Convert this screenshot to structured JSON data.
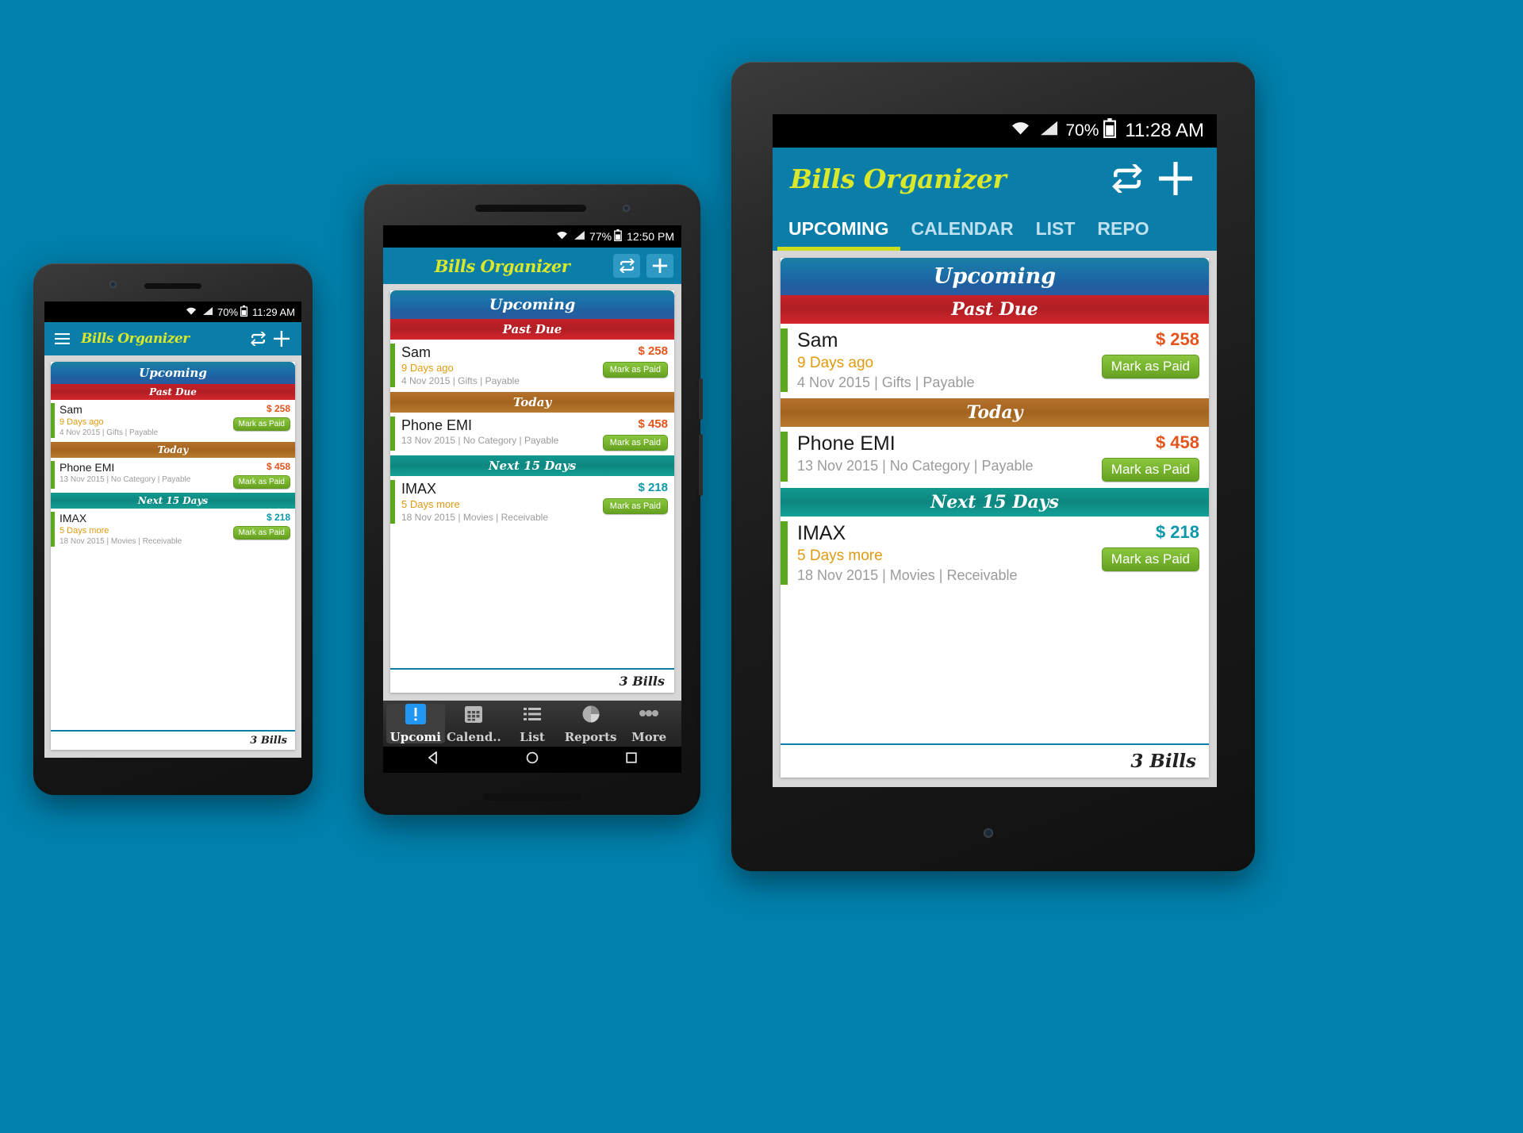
{
  "background_color": "#0080ac",
  "app": {
    "name": "Bills Organizer",
    "accent_color": "#0a7da8",
    "logo_color": "#d9e82a"
  },
  "bills": [
    {
      "section": "Past Due",
      "name": "Sam",
      "when": "9 Days ago",
      "meta": "4 Nov 2015 | Gifts | Payable",
      "amount": "$ 258",
      "amount_color": "#e4541d",
      "action": "Mark as Paid"
    },
    {
      "section": "Today",
      "name": "Phone EMI",
      "when": "",
      "meta": "13 Nov 2015 | No Category | Payable",
      "amount": "$ 458",
      "amount_color": "#e4541d",
      "action": "Mark as Paid"
    },
    {
      "section": "Next 15 Days",
      "name": "IMAX",
      "when": "5 Days more",
      "meta": "18 Nov 2015 | Movies | Receivable",
      "amount": "$ 218",
      "amount_color": "#0f97ab",
      "action": "Mark as Paid"
    }
  ],
  "list": {
    "header": "Upcoming",
    "footer_count": "3 Bills"
  },
  "phone_small": {
    "status": {
      "battery": "70%",
      "time": "11:29 AM",
      "wifi_icon": "wifi-icon",
      "signal_icon": "signal-icon",
      "battery_icon": "battery-icon"
    },
    "menu_icon": "hamburger-menu-icon",
    "repeat_icon": "repeat-icon",
    "add_icon": "plus-icon"
  },
  "phone_medium": {
    "status": {
      "battery": "77%",
      "time": "12:50 PM",
      "wifi_icon": "wifi-icon",
      "signal_icon": "signal-icon",
      "battery_icon": "battery-icon"
    },
    "repeat_icon": "repeat-icon",
    "add_icon": "plus-icon",
    "bottom_tabs": [
      {
        "label": "Upcomi",
        "icon": "alert-exclamation-icon",
        "active": true
      },
      {
        "label": "Calend..",
        "icon": "calendar-grid-icon",
        "active": false
      },
      {
        "label": "List",
        "icon": "list-icon",
        "active": false
      },
      {
        "label": "Reports",
        "icon": "pie-chart-icon",
        "active": false
      },
      {
        "label": "More",
        "icon": "overflow-dots-icon",
        "active": false
      }
    ],
    "nav": {
      "back_icon": "nav-back-triangle-icon",
      "home_icon": "nav-home-circle-icon",
      "recents_icon": "nav-recents-square-icon"
    }
  },
  "tablet": {
    "status": {
      "battery": "70%",
      "time": "11:28 AM",
      "wifi_icon": "wifi-icon",
      "signal_icon": "signal-icon",
      "battery_icon": "battery-icon"
    },
    "repeat_icon": "repeat-icon",
    "add_icon": "plus-icon",
    "tabs": [
      {
        "label": "UPCOMING",
        "active": true
      },
      {
        "label": "CALENDAR",
        "active": false
      },
      {
        "label": "LIST",
        "active": false
      },
      {
        "label": "REPO",
        "active": false
      }
    ],
    "tab_indicator_color": "#c9dd1f"
  }
}
